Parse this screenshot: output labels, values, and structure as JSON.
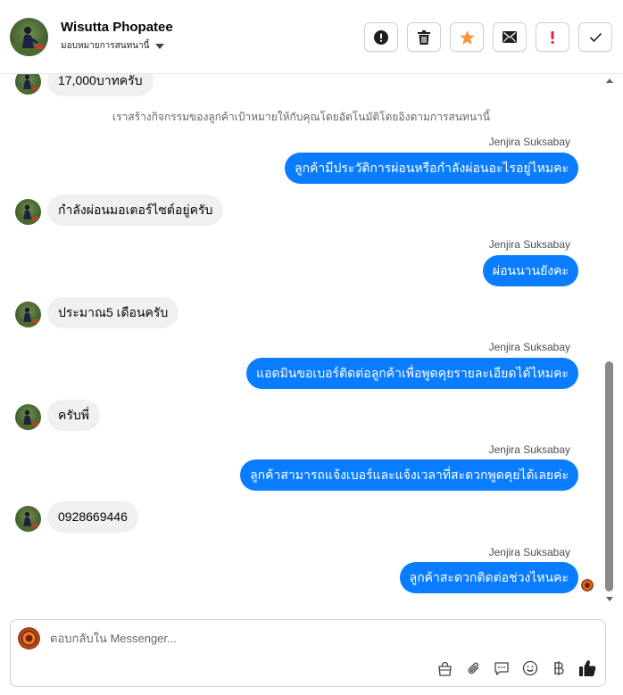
{
  "header": {
    "name": "Wisutta Phopatee",
    "assign_label": "มอบหมายการสนทนานี้"
  },
  "actions": [
    {
      "name": "mark-spam-button",
      "icon": "alert-circle-icon"
    },
    {
      "name": "delete-button",
      "icon": "trash-icon"
    },
    {
      "name": "star-button",
      "icon": "star-icon"
    },
    {
      "name": "mark-unread-button",
      "icon": "envelope-icon"
    },
    {
      "name": "follow-up-button",
      "icon": "exclamation-icon"
    },
    {
      "name": "mark-done-button",
      "icon": "checkmark-icon"
    }
  ],
  "conversation": {
    "system_note": "เราสร้างกิจกรรมของลูกค้าเป้าหมายให้กับคุณโดยอัตโนมัติโดยอิงตามการสนทนานี้",
    "messages": [
      {
        "dir": "in",
        "text": "17,000บาทครับ"
      },
      {
        "dir": "out",
        "sender": "Jenjira Suksabay",
        "text": "ลูกค้ามีประวัติการผ่อนหรือกำลังผ่อนอะไรอยู่ไหมคะ"
      },
      {
        "dir": "in",
        "text": "กำลังผ่อนมอเตอร์ไซต์อยู่ครับ"
      },
      {
        "dir": "out",
        "sender": "Jenjira Suksabay",
        "text": "ผ่อนนานยังคะ"
      },
      {
        "dir": "in",
        "text": "ประมาณ5 เดือนครับ"
      },
      {
        "dir": "out",
        "sender": "Jenjira Suksabay",
        "text": "แอดมินขอเบอร์ติดต่อลูกค้าเพื่อพูดคุยรายละเอียดได้ไหมคะ"
      },
      {
        "dir": "in",
        "text": "ครับพี่"
      },
      {
        "dir": "out",
        "sender": "Jenjira Suksabay",
        "text": "ลูกค้าสามารถแจ้งเบอร์และแจ้งเวลาที่สะดวกพูดคุยได้เลยค่ะ"
      },
      {
        "dir": "in",
        "text": "0928669446"
      },
      {
        "dir": "out",
        "sender": "Jenjira Suksabay",
        "text": "ลูกค้าสะดวกติดต่อช่วงไหนคะ"
      }
    ]
  },
  "composer": {
    "placeholder": "ตอบกลับใน Messenger...",
    "tools": [
      "shopping-bag-icon",
      "paperclip-icon",
      "saved-reply-icon",
      "emoji-icon",
      "baht-icon",
      "thumbs-up-icon"
    ]
  },
  "colors": {
    "outgoing_bubble": "#0a7cff",
    "incoming_bubble": "#f0f0f0",
    "star": "#f7923b",
    "follow_up": "#e41e3f"
  }
}
